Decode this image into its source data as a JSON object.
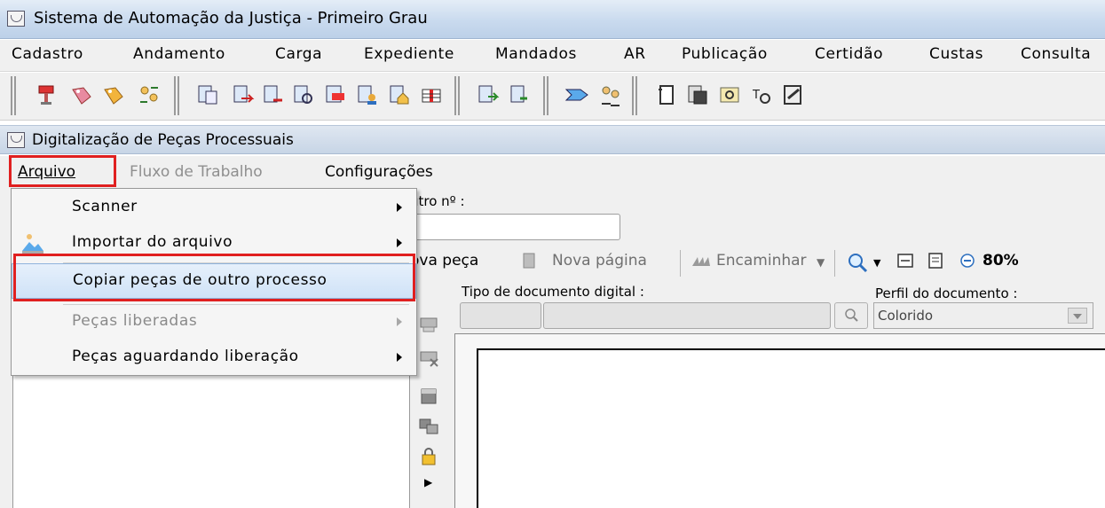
{
  "window": {
    "title": "Sistema de Automação da Justiça - Primeiro Grau"
  },
  "menubar": {
    "items": [
      "Cadastro",
      "Andamento",
      "Carga",
      "Expediente",
      "Mandados",
      "AR",
      "Publicação",
      "Certidão",
      "Custas",
      "Consulta"
    ]
  },
  "inner_window": {
    "title": "Digitalização de Peças Processuais",
    "menu": {
      "arquivo": "Arquivo",
      "fluxo": "Fluxo de Trabalho",
      "configuracoes": "Configurações"
    }
  },
  "form": {
    "outro_label": "utro nº :",
    "outro_value": ""
  },
  "doc_toolbar": {
    "nova_peca": "ova peça",
    "nova_pagina": "Nova página",
    "encaminhar": "Encaminhar",
    "zoom": "80%"
  },
  "fields": {
    "tipo_label": "Tipo de documento digital :",
    "perfil_label": "Perfil do documento :",
    "perfil_value": "Colorido"
  },
  "dropdown": {
    "items": [
      {
        "label": "Scanner",
        "submenu": true,
        "disabled": false
      },
      {
        "label": "Importar do arquivo",
        "submenu": true,
        "disabled": false
      },
      {
        "label": "Copiar peças de outro processo",
        "submenu": false,
        "disabled": false,
        "highlighted": true
      },
      {
        "label": "Peças liberadas",
        "submenu": true,
        "disabled": true
      },
      {
        "label": "Peças aguardando liberação",
        "submenu": true,
        "disabled": false
      }
    ]
  },
  "colors": {
    "highlight_box": "#e02020",
    "menu_hover": "#cfe2f7"
  }
}
